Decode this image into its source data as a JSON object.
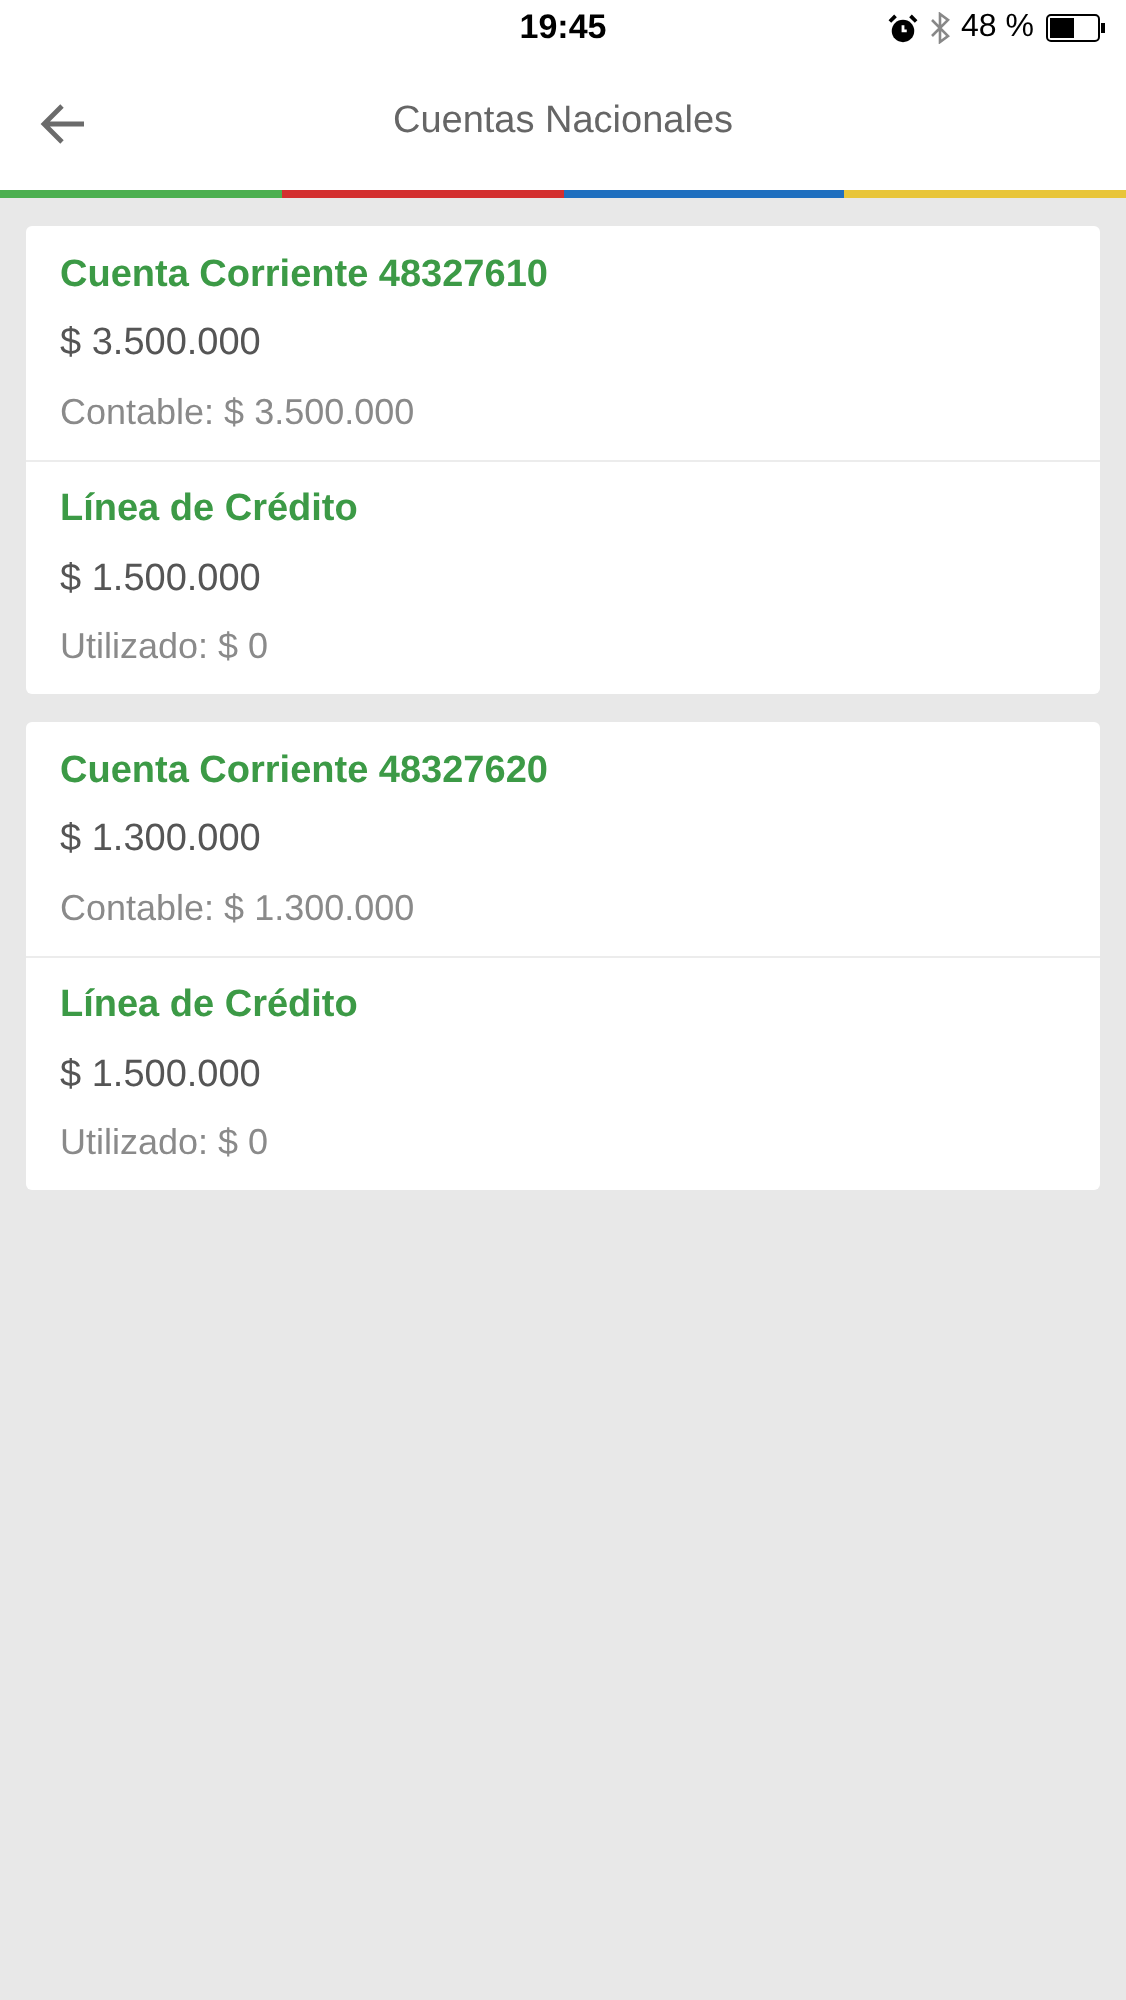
{
  "status_bar": {
    "time": "19:45",
    "battery": "48 %"
  },
  "header": {
    "title": "Cuentas Nacionales"
  },
  "cards": [
    {
      "rows": [
        {
          "title": "Cuenta Corriente 48327610",
          "amount": "$ 3.500.000",
          "detail": "Contable: $ 3.500.000"
        },
        {
          "title": "Línea de Crédito",
          "amount": "$ 1.500.000",
          "detail": "Utilizado: $ 0"
        }
      ]
    },
    {
      "rows": [
        {
          "title": "Cuenta Corriente 48327620",
          "amount": "$ 1.300.000",
          "detail": "Contable: $ 1.300.000"
        },
        {
          "title": "Línea de Crédito",
          "amount": "$ 1.500.000",
          "detail": "Utilizado: $ 0"
        }
      ]
    }
  ]
}
